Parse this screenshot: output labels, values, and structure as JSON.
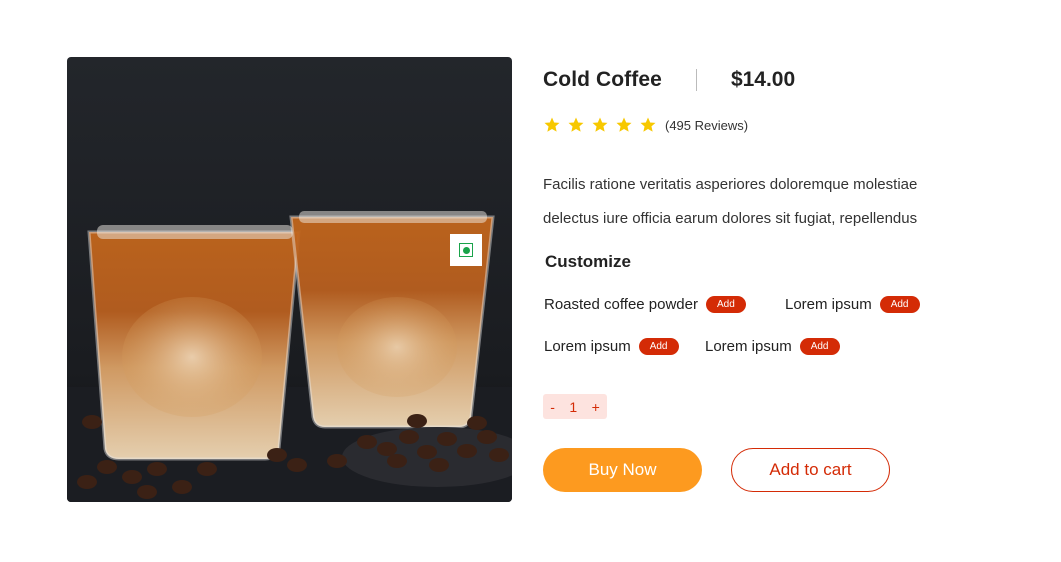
{
  "product": {
    "name": "Cold Coffee",
    "price": "$14.00",
    "rating_stars": 5,
    "reviews": "(495 Reviews)",
    "description": [
      "Facilis ratione veritatis asperiores doloremque molestiae",
      "delectus iure officia earum dolores sit fugiat, repellendus"
    ],
    "image_icon": "veg-indicator-icon"
  },
  "customize": {
    "title": "Customize",
    "add_label": "Add",
    "options": [
      "Roasted coffee powder",
      "Lorem ipsum",
      "Lorem ipsum",
      "Lorem ipsum"
    ]
  },
  "quantity": {
    "minus": "-",
    "value": "1",
    "plus": "+"
  },
  "actions": {
    "buy_now": "Buy Now",
    "add_to_cart": "Add to cart"
  },
  "colors": {
    "accent_orange": "#fd9a1f",
    "accent_red": "#d42b06",
    "star": "#f7c800",
    "veg_green": "#1aa34a"
  }
}
